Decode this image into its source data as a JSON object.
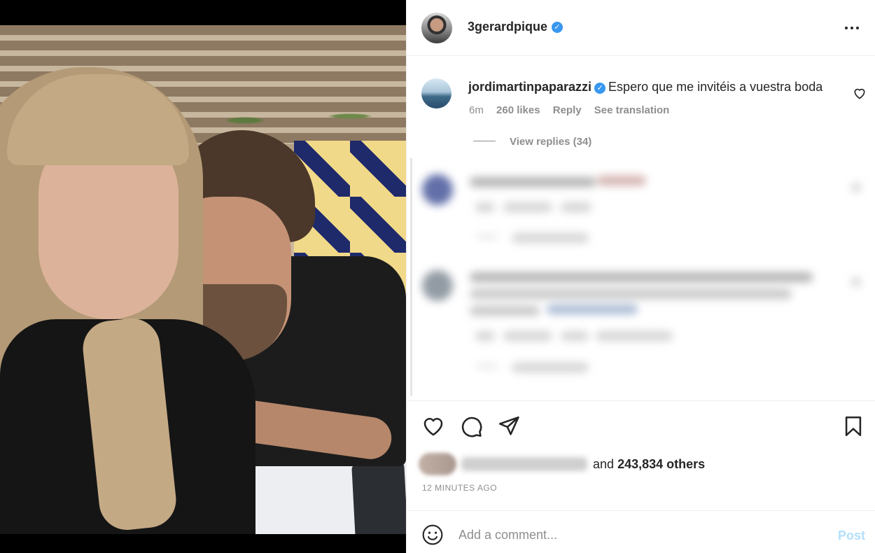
{
  "post": {
    "author": {
      "username": "3gerardpique",
      "verified_icon": "verified-badge-icon",
      "more_icon": "more-options-icon"
    },
    "comment": {
      "username": "jordimartinpaparazzi",
      "verified_icon": "verified-badge-icon",
      "text": "Espero que me invitéis a vuestra boda",
      "time": "6m",
      "likes": "260 likes",
      "reply_label": "Reply",
      "see_translation_label": "See translation",
      "view_replies_label": "View replies (34)",
      "like_icon": "heart-outline-icon"
    },
    "actions": {
      "like_icon": "heart-outline-icon",
      "comment_icon": "comment-bubble-icon",
      "share_icon": "paper-plane-icon",
      "save_icon": "bookmark-icon"
    },
    "likes": {
      "and_label": "and",
      "others_count": "243,834 others"
    },
    "timestamp": "12 MINUTES AGO",
    "add_comment": {
      "placeholder": "Add a comment...",
      "post_label": "Post",
      "emoji_icon": "smiley-face-icon"
    }
  },
  "colors": {
    "text": "#262626",
    "secondary_text": "#8e8e8e",
    "verified_blue": "#3897f0",
    "post_button_disabled": "#b2dffc",
    "divider": "#efefef"
  }
}
